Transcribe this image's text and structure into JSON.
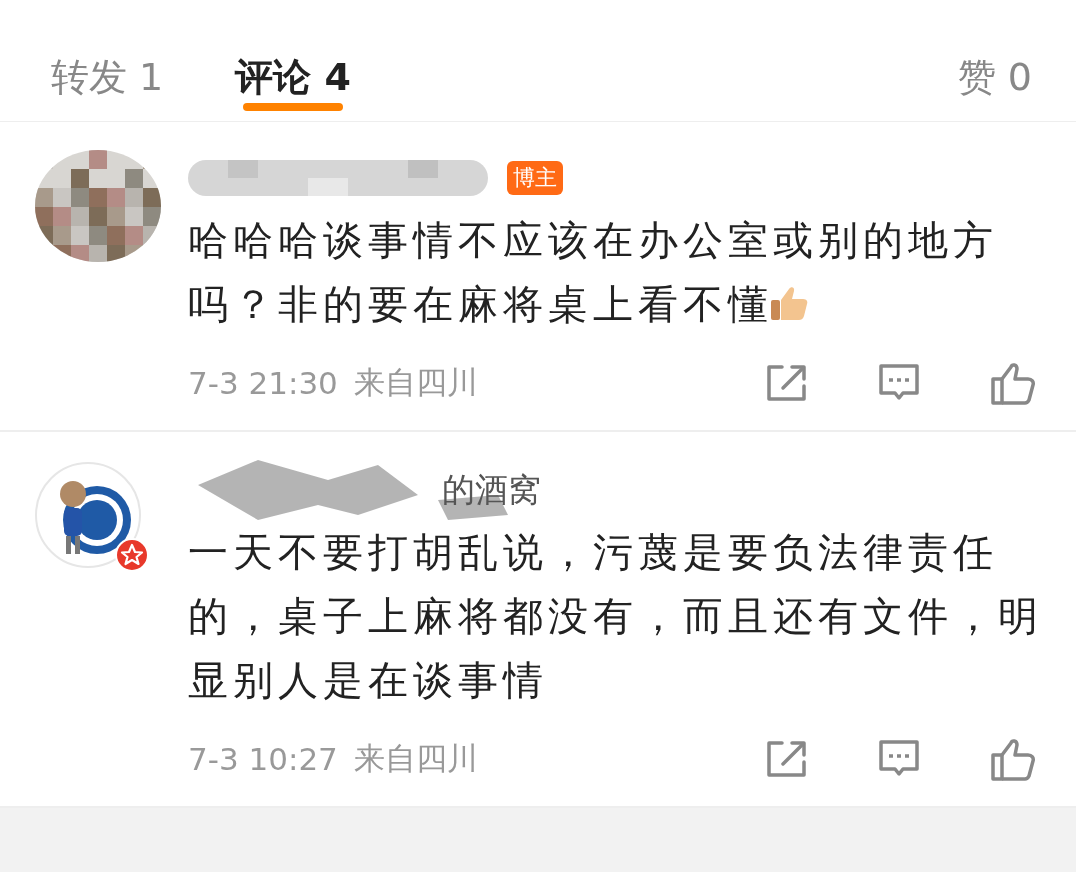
{
  "tabs": [
    {
      "label": "转发 1",
      "selected": false
    },
    {
      "label": "评论 4",
      "selected": true
    },
    {
      "label": "赞 0",
      "selected": false
    }
  ],
  "comments": [
    {
      "name_redacted": true,
      "author_badge": "博主",
      "text": "哈哈哈谈事情不应该在办公室或别的地方吗？非的要在麻将桌上看不懂",
      "ends_with_emoji": true,
      "time": "7-3 21:30",
      "location": "来自四川"
    },
    {
      "avatar": {
        "kind": "illustration"
      },
      "verified": true,
      "name_redacted": true,
      "author_visible": "的酒窝",
      "text": "一天不要打胡乱说，污蔑是要负法律责任的，桌子上麻将都没有，而且还有文件，明显别人是在谈事情",
      "time": "7-3 10:27",
      "location": "来自四川"
    }
  ]
}
